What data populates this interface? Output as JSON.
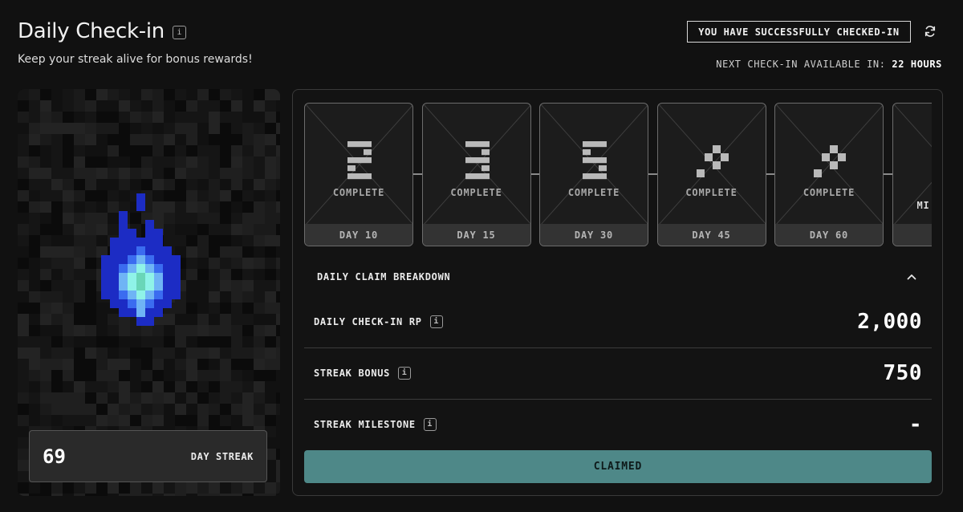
{
  "header": {
    "title": "Daily Check-in",
    "subtitle": "Keep your streak alive for bonus rewards!",
    "status": "YOU HAVE SUCCESSFULLY CHECKED-IN",
    "next_label": "NEXT CHECK-IN AVAILABLE IN:",
    "next_value": "22 HOURS"
  },
  "streak": {
    "count": "69",
    "label": "DAY STREAK"
  },
  "milestones": [
    {
      "glyph": "2",
      "status": "COMPLETE",
      "day": "DAY 10"
    },
    {
      "glyph": "3",
      "status": "COMPLETE",
      "day": "DAY 15"
    },
    {
      "glyph": "5",
      "status": "COMPLETE",
      "day": "DAY 30"
    },
    {
      "glyph": "wand",
      "status": "COMPLETE",
      "day": "DAY 45"
    },
    {
      "glyph": "wand",
      "status": "COMPLETE",
      "day": "DAY 60"
    },
    {
      "glyph": "",
      "status": "MI",
      "day": "D"
    }
  ],
  "breakdown": {
    "heading": "DAILY CLAIM BREAKDOWN",
    "rows": [
      {
        "label": "DAILY CHECK-IN RP",
        "value": "2,000"
      },
      {
        "label": "STREAK BONUS",
        "value": "750"
      },
      {
        "label": "STREAK MILESTONE",
        "value": "-"
      }
    ]
  },
  "claim_button": "CLAIMED",
  "icons": {
    "info": "info-icon",
    "refresh": "refresh-icon",
    "collapse": "chevron-up-icon",
    "flame": "blue-flame-icon"
  },
  "colors": {
    "background": "#111111",
    "claim_button": "#4e8888",
    "flame_dark": "#1c2cc4",
    "flame_mid": "#3b6cf0",
    "flame_core": "#8ff3e8"
  }
}
